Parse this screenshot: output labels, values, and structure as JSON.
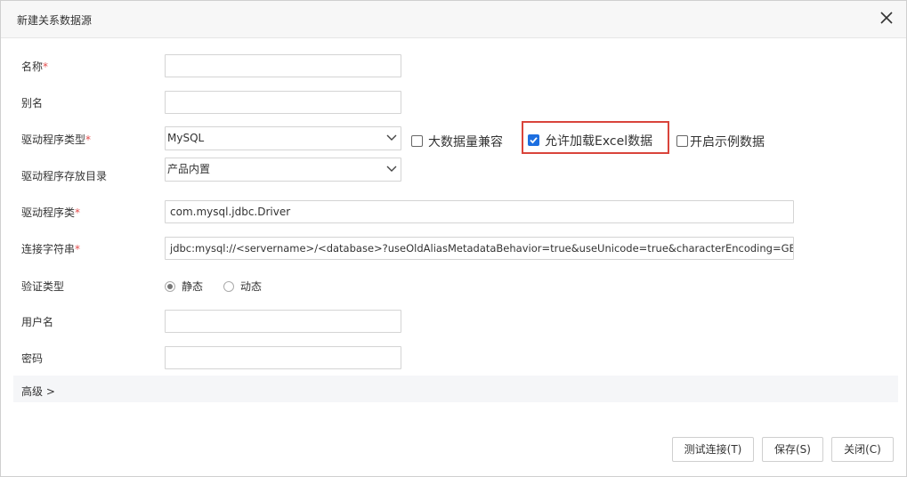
{
  "dialog": {
    "title": "新建关系数据源"
  },
  "form": {
    "name": {
      "label": "名称",
      "required_mark": "*",
      "value": ""
    },
    "alias": {
      "label": "别名",
      "value": ""
    },
    "driver_type": {
      "label": "驱动程序类型",
      "required_mark": "*",
      "selected": "MySQL",
      "options": {
        "big_data_compat": {
          "label": "大数据量兼容",
          "checked": false
        },
        "allow_excel": {
          "label": "允许加载Excel数据",
          "checked": true
        },
        "sample_data": {
          "label": "开启示例数据",
          "checked": false
        }
      }
    },
    "driver_dir": {
      "label": "驱动程序存放目录",
      "selected": "产品内置"
    },
    "driver_class": {
      "label": "驱动程序类",
      "required_mark": "*",
      "value": "com.mysql.jdbc.Driver"
    },
    "connection_string": {
      "label": "连接字符串",
      "required_mark": "*",
      "value": "jdbc:mysql://<servername>/<database>?useOldAliasMetadataBehavior=true&useUnicode=true&characterEncoding=GBK"
    },
    "auth_type": {
      "label": "验证类型",
      "options": [
        "静态",
        "动态"
      ],
      "selected": "静态"
    },
    "username": {
      "label": "用户名",
      "value": ""
    },
    "password": {
      "label": "密码",
      "value": ""
    },
    "advanced": {
      "label": "高级 >"
    }
  },
  "buttons": {
    "test": "测试连接(T)",
    "save": "保存(S)",
    "close": "关闭(C)"
  },
  "colors": {
    "accent": "#1d6fe0",
    "highlight": "#d9443b",
    "required": "#e34d4d"
  }
}
